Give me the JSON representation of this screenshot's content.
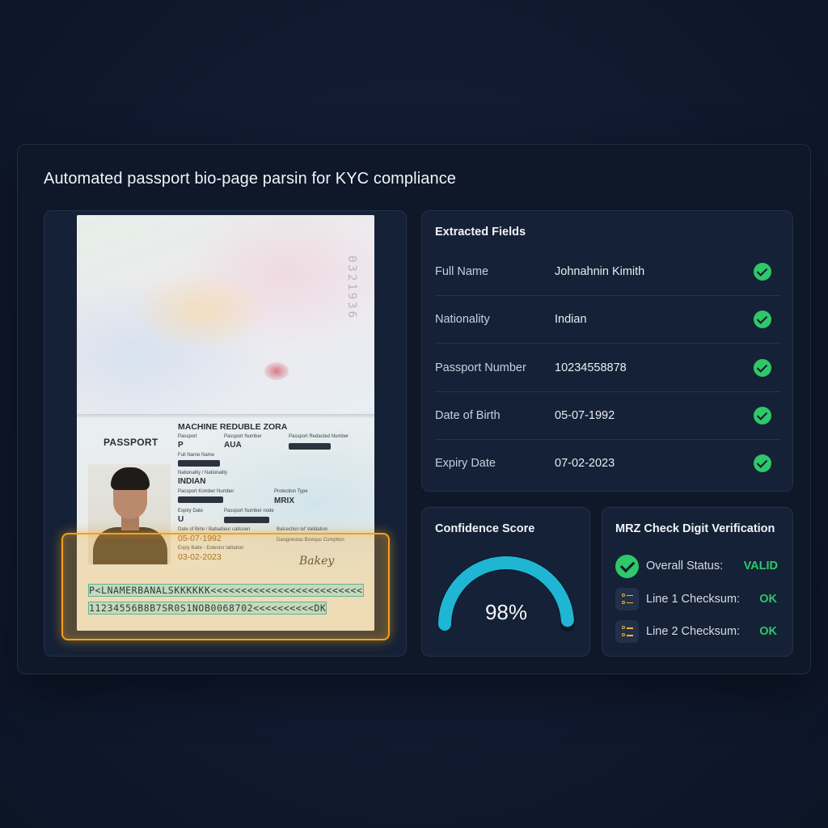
{
  "page": {
    "title": "Automated passport bio-page parsin for KYC compliance"
  },
  "passport": {
    "serial": "0321936",
    "word": "PASSPORT",
    "heading": "MACHINE REDUBLE ZORA",
    "labels": {
      "passport": "Passport",
      "passport_number": "Passport Number",
      "passport_redacted_number": "Passport Redacted Number",
      "full_name": "Full Name Name",
      "nationality": "Nationality / Nationality",
      "passport_komber_number": "Pacsport Komber Number",
      "protection_type": "Protection Type",
      "expiry_date": "Expiry Date",
      "passport_number_node": "Passport Number node",
      "date_of_birth": "Date of Birle / Babadieur caltosen",
      "selection_validation": "Balcection lof Validation",
      "expiry_date_2": "Expiy Balte - Eotestor lalitation",
      "designation": "Dasignestas Boviqus Comptton"
    },
    "values": {
      "type": "P",
      "code": "AUA",
      "nationality": "INDIAN",
      "protection_type": "MRIX",
      "sex": "U",
      "dob": "05-07-1992",
      "expiry": "03-02-2023"
    },
    "signature": "Bakey",
    "mrz_line_1": "P<LNAMERBANALSKKKKKK<<<<<<<<<<<<<<<<<<<<<<<<<",
    "mrz_line_2": "11234556B8B7SR0S1NOB0068702<<<<<<<<<<DK"
  },
  "extracted_fields": {
    "title": "Extracted Fields",
    "rows": [
      {
        "label": "Full Name",
        "value": "Johnahnin Kimith",
        "status": "check"
      },
      {
        "label": "Nationality",
        "value": "Indian",
        "status": "check"
      },
      {
        "label": "Passport Number",
        "value": "10234558878",
        "status": "check"
      },
      {
        "label": "Date of Birth",
        "value": "05-07-1992",
        "status": "check"
      },
      {
        "label": "Expiry Date",
        "value": "07-02-2023",
        "status": "check"
      }
    ]
  },
  "confidence": {
    "title": "Confidence Score",
    "value_text": "98%",
    "value": 0.98
  },
  "mrz_check": {
    "title": "MRZ Check Digit Verification",
    "rows": [
      {
        "label": "Overall Status:",
        "value": "VALID",
        "icon": "check-circle-icon"
      },
      {
        "label": "Line 1 Checksum:",
        "value": "OK",
        "icon": "list-checklist-icon"
      },
      {
        "label": "Line 2 Checksum:",
        "value": "OK",
        "icon": "list-checklist-icon"
      }
    ]
  },
  "colors": {
    "accent_success": "#2ec76a",
    "accent_highlight": "#f2a219",
    "gauge": "#1fb6d4",
    "background": "#101a30"
  }
}
